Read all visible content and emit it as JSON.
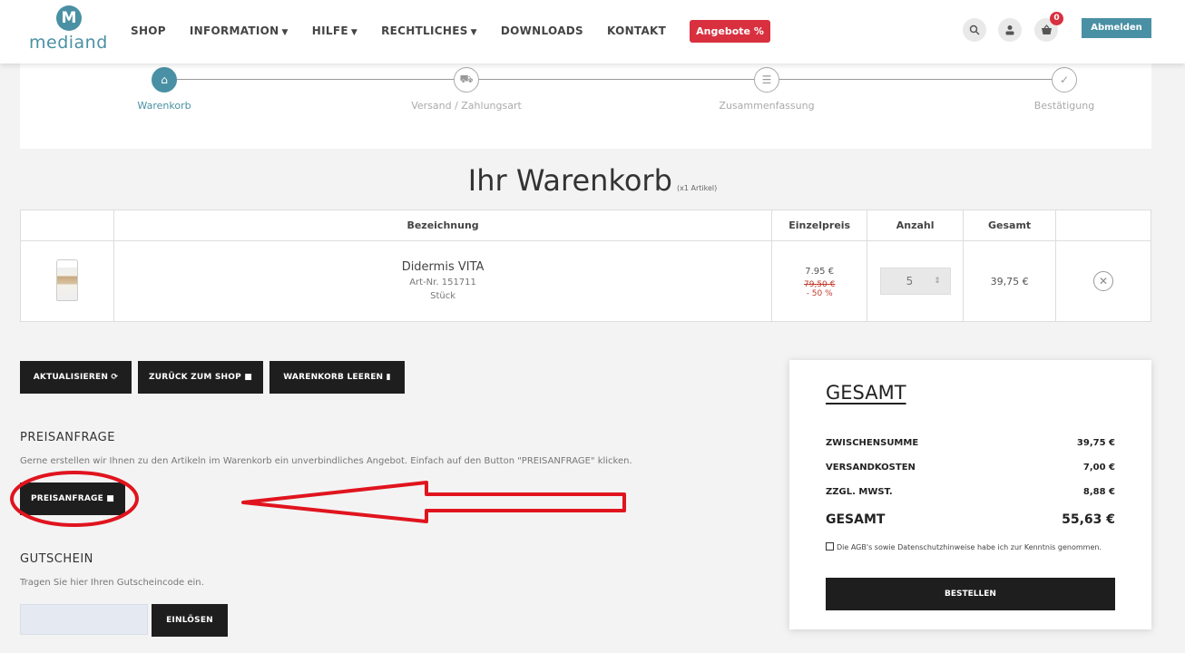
{
  "header": {
    "logo_letter": "M",
    "logo_text": "mediand",
    "nav": [
      {
        "label": "SHOP",
        "dropdown": false
      },
      {
        "label": "INFORMATION",
        "dropdown": true
      },
      {
        "label": "HILFE",
        "dropdown": true
      },
      {
        "label": "RECHTLICHES",
        "dropdown": true
      },
      {
        "label": "DOWNLOADS",
        "dropdown": false
      },
      {
        "label": "KONTAKT",
        "dropdown": false
      }
    ],
    "offer_label": "Angebote %",
    "cart_count": "0",
    "logout_label": "Abmelden",
    "icons": [
      "search-icon",
      "user-icon",
      "cart-icon"
    ]
  },
  "steps": [
    {
      "label": "Warenkorb",
      "icon": "basket-icon",
      "glyph": "⌂",
      "active": true
    },
    {
      "label": "Versand / Zahlungsart",
      "icon": "truck-icon",
      "glyph": "⛟",
      "active": false
    },
    {
      "label": "Zusammenfassung",
      "icon": "list-icon",
      "glyph": "☰",
      "active": false
    },
    {
      "label": "Bestätigung",
      "icon": "check-icon",
      "glyph": "✓",
      "active": false
    }
  ],
  "title": {
    "main": "Ihr Warenkorb",
    "count": "(x1 Artikel)"
  },
  "table": {
    "headers": [
      "",
      "Bezeichnung",
      "Einzelpreis",
      "Anzahl",
      "Gesamt",
      ""
    ],
    "row": {
      "name": "Didermis VITA",
      "art_nr": "Art-Nr. 151711",
      "unit": "Stück",
      "price": "7.95 €",
      "price_old": "79,50 €",
      "discount": "- 50 %",
      "quantity": "5",
      "total": "39,75 €"
    }
  },
  "actions": {
    "update": "AKTUALISIEREN",
    "back": "ZURÜCK ZUM SHOP",
    "clear": "WARENKORB LEEREN"
  },
  "quote": {
    "title": "PREISANFRAGE",
    "text": "Gerne erstellen wir Ihnen zu den Artikeln im Warenkorb ein unverbindliches Angebot. Einfach auf den Button \"PREISANFRAGE\" klicken.",
    "button": "PREISANFRAGE"
  },
  "voucher": {
    "title": "GUTSCHEIN",
    "text": "Tragen Sie hier Ihren Gutscheincode ein.",
    "input_value": "",
    "button": "EINLÖSEN"
  },
  "summary": {
    "title": "GESAMT",
    "rows": [
      {
        "label": "ZWISCHENSUMME",
        "value": "39,75 €"
      },
      {
        "label": "VERSANDKOSTEN",
        "value": "7,00 €"
      },
      {
        "label": "ZZGL. MWST.",
        "value": "8,88 €"
      }
    ],
    "total_label": "GESAMT",
    "total_value": "55,63 €",
    "terms": "Die AGB's sowie Datenschutzhinweise habe ich zur Kenntnis genommen.",
    "order_button": "BESTELLEN"
  },
  "colors": {
    "brand": "#4a90a4",
    "offer": "#d9303f",
    "annotation": "#e0141e",
    "button": "#1e1e1e"
  }
}
